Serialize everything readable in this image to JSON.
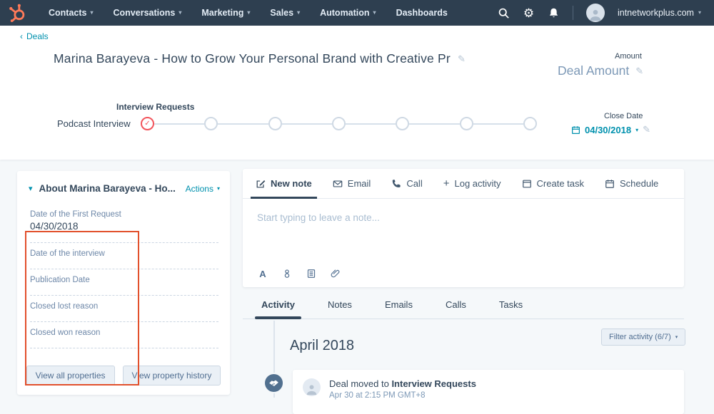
{
  "nav": {
    "items": [
      {
        "label": "Contacts",
        "caret": "▾"
      },
      {
        "label": "Conversations",
        "caret": "▾"
      },
      {
        "label": "Marketing",
        "caret": "▾"
      },
      {
        "label": "Sales",
        "caret": "▾"
      },
      {
        "label": "Automation",
        "caret": "▾"
      },
      {
        "label": "Dashboards",
        "caret": ""
      }
    ],
    "account": "intnetworkplus.com",
    "account_caret": "▾"
  },
  "breadcrumb": {
    "chevron": "‹",
    "label": "Deals"
  },
  "deal": {
    "title": "Marina Barayeva - How to Grow Your Personal Brand with Creative Pr",
    "amount": {
      "label": "Amount",
      "value": "Deal Amount"
    },
    "close_date": {
      "label": "Close Date",
      "value": "04/30/2018",
      "caret": "▾"
    },
    "pipeline": {
      "current_stage_label": "Interview Requests",
      "pipeline_name": "Podcast Interview",
      "total_stages": 7,
      "completed_stages": 1
    }
  },
  "about": {
    "collapse_caret": "▾",
    "title": "About Marina Barayeva - Ho...",
    "actions_label": "Actions",
    "actions_caret": "▾",
    "fields": [
      {
        "label": "Date of the First Request",
        "value": "04/30/2018"
      },
      {
        "label": "Date of the interview",
        "value": ""
      },
      {
        "label": "Publication Date",
        "value": ""
      },
      {
        "label": "Closed lost reason",
        "value": ""
      },
      {
        "label": "Closed won reason",
        "value": ""
      }
    ],
    "view_all_properties": "View all properties",
    "view_property_history": "View property history"
  },
  "composer": {
    "tabs": [
      {
        "label": "New note",
        "active": true
      },
      {
        "label": "Email",
        "active": false
      },
      {
        "label": "Call",
        "active": false
      },
      {
        "label": "Log activity",
        "active": false
      },
      {
        "label": "Create task",
        "active": false
      },
      {
        "label": "Schedule",
        "active": false
      }
    ],
    "placeholder": "Start typing to leave a note...",
    "toolbar": [
      "format-text-icon",
      "personalization-icon",
      "document-icon",
      "paperclip-icon"
    ]
  },
  "activity": {
    "tabs": [
      {
        "label": "Activity",
        "active": true
      },
      {
        "label": "Notes",
        "active": false
      },
      {
        "label": "Emails",
        "active": false
      },
      {
        "label": "Calls",
        "active": false
      },
      {
        "label": "Tasks",
        "active": false
      }
    ],
    "filter_button": "Filter activity (6/7)",
    "filter_caret": "▾",
    "month_heading": "April 2018",
    "events": [
      {
        "text_prefix": "Deal moved to ",
        "stage": "Interview Requests",
        "timestamp": "Apr 30 at 2:15 PM GMT+8"
      }
    ]
  },
  "icons": {
    "hubspot-logo": "sprocket",
    "search-icon": "magnifier",
    "settings-icon": "⚙",
    "notifications-icon": "bell",
    "edit-pencil-icon": "✎",
    "stage-check-icon": "✓",
    "plus-icon": "+",
    "format-a-icon": "A",
    "new-note-icon": "compose-square",
    "email-icon": "envelope",
    "call-icon": "phone-handset",
    "create-task-icon": "window",
    "schedule-icon": "calendar",
    "close-date-calendar-icon": "calendar",
    "handshake-icon": "handshake",
    "avatar-icon": "person-silhouette"
  },
  "colors": {
    "nav_bg": "#2e3f50",
    "brand_orange": "#ff7a59",
    "link_teal": "#0091ae",
    "text_slate": "#33475b",
    "muted_blue": "#7c98b6",
    "annotation_red": "#e2502c",
    "stage_coral": "#f2545b",
    "page_bg": "#f5f8fa"
  }
}
